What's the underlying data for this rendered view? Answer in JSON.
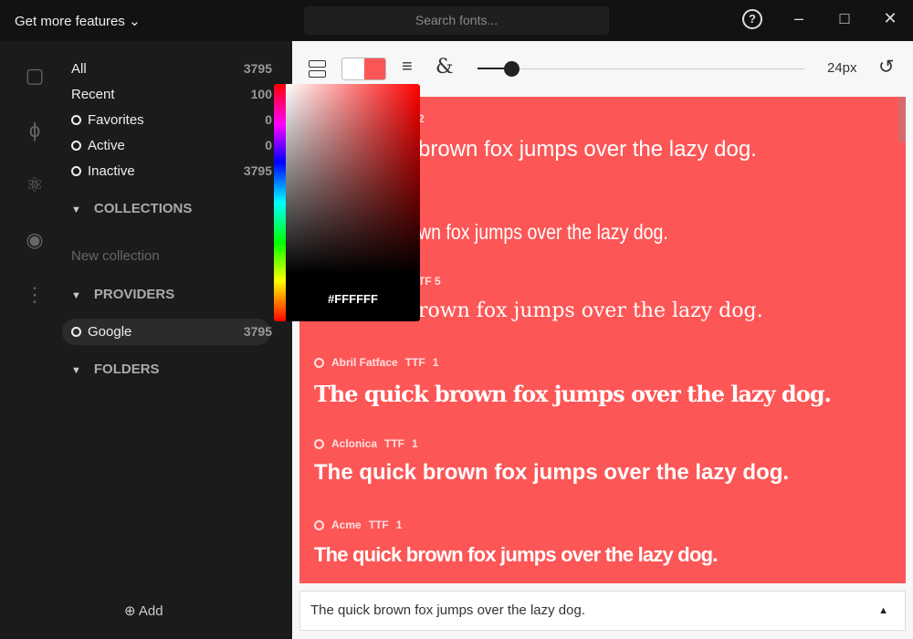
{
  "topbar": {
    "features": "Get more features",
    "search_placeholder": "Search fonts..."
  },
  "sidebar": {
    "items": [
      {
        "label": "All",
        "count": "3795"
      },
      {
        "label": "Recent",
        "count": "100"
      },
      {
        "label": "Favorites",
        "count": "0"
      },
      {
        "label": "Active",
        "count": "0"
      },
      {
        "label": "Inactive",
        "count": "3795"
      }
    ],
    "collections": "COLLECTIONS",
    "new_collection": "New collection",
    "providers": "PROVIDERS",
    "provider": {
      "label": "Google",
      "count": "3795"
    },
    "folders": "FOLDERS",
    "add": "Add"
  },
  "toolbar": {
    "size": "24px",
    "text_color": "#FFFFFF",
    "bg_color": "#FD5656"
  },
  "picker": {
    "hex": "#FFFFFF"
  },
  "fonts": [
    {
      "meta": "2",
      "sample": "brown fox jumps over the lazy dog."
    },
    {
      "meta": "",
      "sample": "wn fox jumps over the lazy dog."
    },
    {
      "meta": "TF  5",
      "sample": "rown fox jumps over the lazy dog."
    },
    {
      "name": "Abril Fatface",
      "type": "TTF",
      "count": "1",
      "sample": "The quick brown fox jumps over the lazy dog."
    },
    {
      "name": "Aclonica",
      "type": "TTF",
      "count": "1",
      "sample": "The quick brown fox jumps over the lazy dog."
    },
    {
      "name": "Acme",
      "type": "TTF",
      "count": "1",
      "sample": "The quick brown fox jumps over the lazy dog."
    }
  ],
  "preview_text": "The quick brown fox jumps over the lazy dog."
}
